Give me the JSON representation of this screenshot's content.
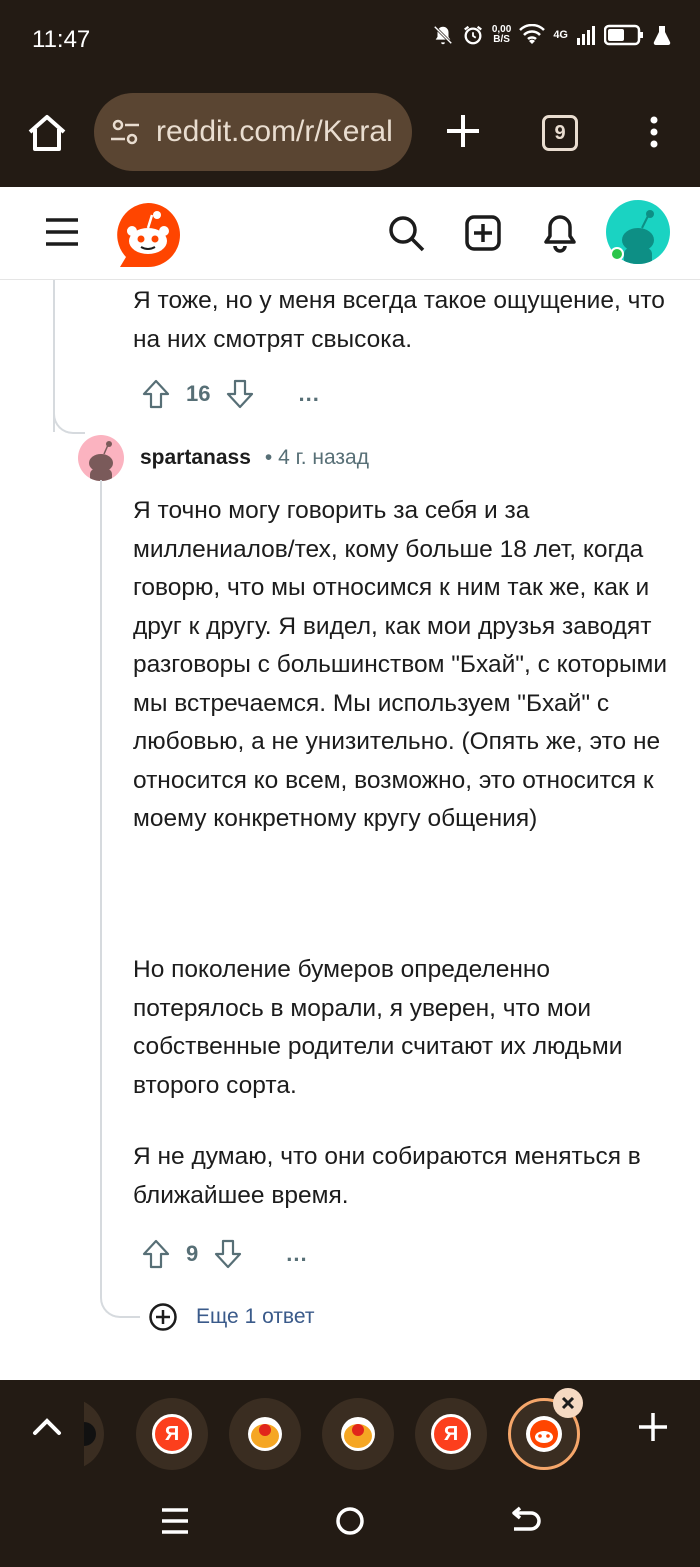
{
  "status_bar": {
    "time": "11:47",
    "net_speed_value": "0,00",
    "net_speed_unit": "B/S",
    "network": "4G"
  },
  "browser": {
    "url": "reddit.com/r/Kerala",
    "tab_count": "9"
  },
  "comments": {
    "parent_text": "Я тоже, но у меня всегда такое ощущение, что на них смотрят свысока.",
    "parent_votes": "16",
    "reply": {
      "username": "spartanass",
      "meta": "• 4 г. назад",
      "paragraphs": [
        "Я точно могу говорить за себя и за миллениалов/тех, кому больше 18 лет, когда говорю, что мы относимся к ним так же, как и друг к другу. Я видел, как мои друзья заводят разговоры с большинством \"Бхай\", с которыми мы встречаемся. Мы используем \"Бхай\" с любовью, а не унизительно. (Опять же, это не относится ко всем, возможно, это относится к моему конкретному кругу общения)",
        "Но поколение бумеров определенно потерялось в морали, я уверен, что мои собственные родители считают их людьми второго сорта.",
        "Я не думаю, что они собираются меняться в ближайшее время."
      ],
      "votes": "9",
      "more_label": "...",
      "more_replies": "Еще 1 ответ"
    }
  },
  "tab_strip": {
    "yandex_letter": "Я"
  },
  "colors": {
    "chrome_bg": "#231b14",
    "reddit_orange": "#ff4500",
    "link_blue": "#3a5a8a",
    "meta_gray": "#576f76"
  }
}
